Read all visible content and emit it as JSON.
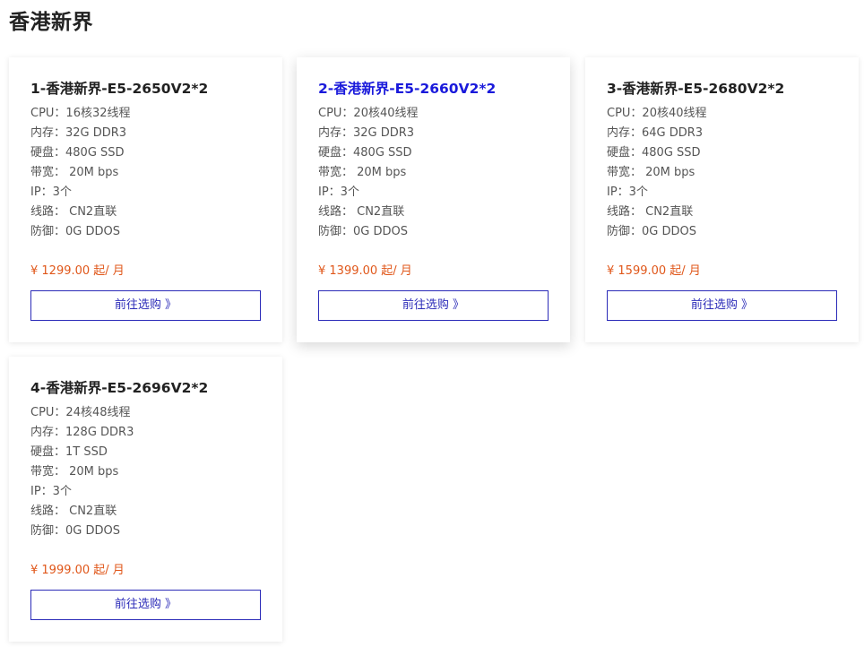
{
  "page_title": "香港新界",
  "cards": [
    {
      "title": "1-香港新界-E5-2650V2*2",
      "specs": [
        "CPU：16核32线程",
        "内存：32G DDR3",
        "硬盘：480G SSD",
        "带宽：  20M bps",
        "IP：3个",
        "线路：  CN2直联",
        "防御：0G DDOS"
      ],
      "price": "¥ 1299.00 起/ 月",
      "button": "前往选购 》"
    },
    {
      "title": "2-香港新界-E5-2660V2*2",
      "specs": [
        "CPU：20核40线程",
        "内存：32G DDR3",
        "硬盘：480G SSD",
        "带宽：  20M bps",
        "IP：3个",
        "线路：  CN2直联",
        "防御：0G DDOS"
      ],
      "price": "¥ 1399.00 起/ 月",
      "button": "前往选购 》"
    },
    {
      "title": "3-香港新界-E5-2680V2*2",
      "specs": [
        "CPU：20核40线程",
        "内存：64G DDR3",
        "硬盘：480G SSD",
        "带宽：  20M bps",
        "IP：3个",
        "线路：  CN2直联",
        "防御：0G DDOS"
      ],
      "price": "¥ 1599.00 起/ 月",
      "button": "前往选购 》"
    },
    {
      "title": "4-香港新界-E5-2696V2*2",
      "specs": [
        "CPU：24核48线程",
        "内存：128G DDR3",
        "硬盘：1T SSD",
        "带宽：  20M bps",
        "IP：3个",
        "线路：  CN2直联",
        "防御：0G DDOS"
      ],
      "price": "¥ 1999.00 起/ 月",
      "button": "前往选购 》"
    }
  ],
  "colors": {
    "price": "#e0571a",
    "button_border": "#2b2bb8",
    "hover_title": "#1a1adb"
  }
}
